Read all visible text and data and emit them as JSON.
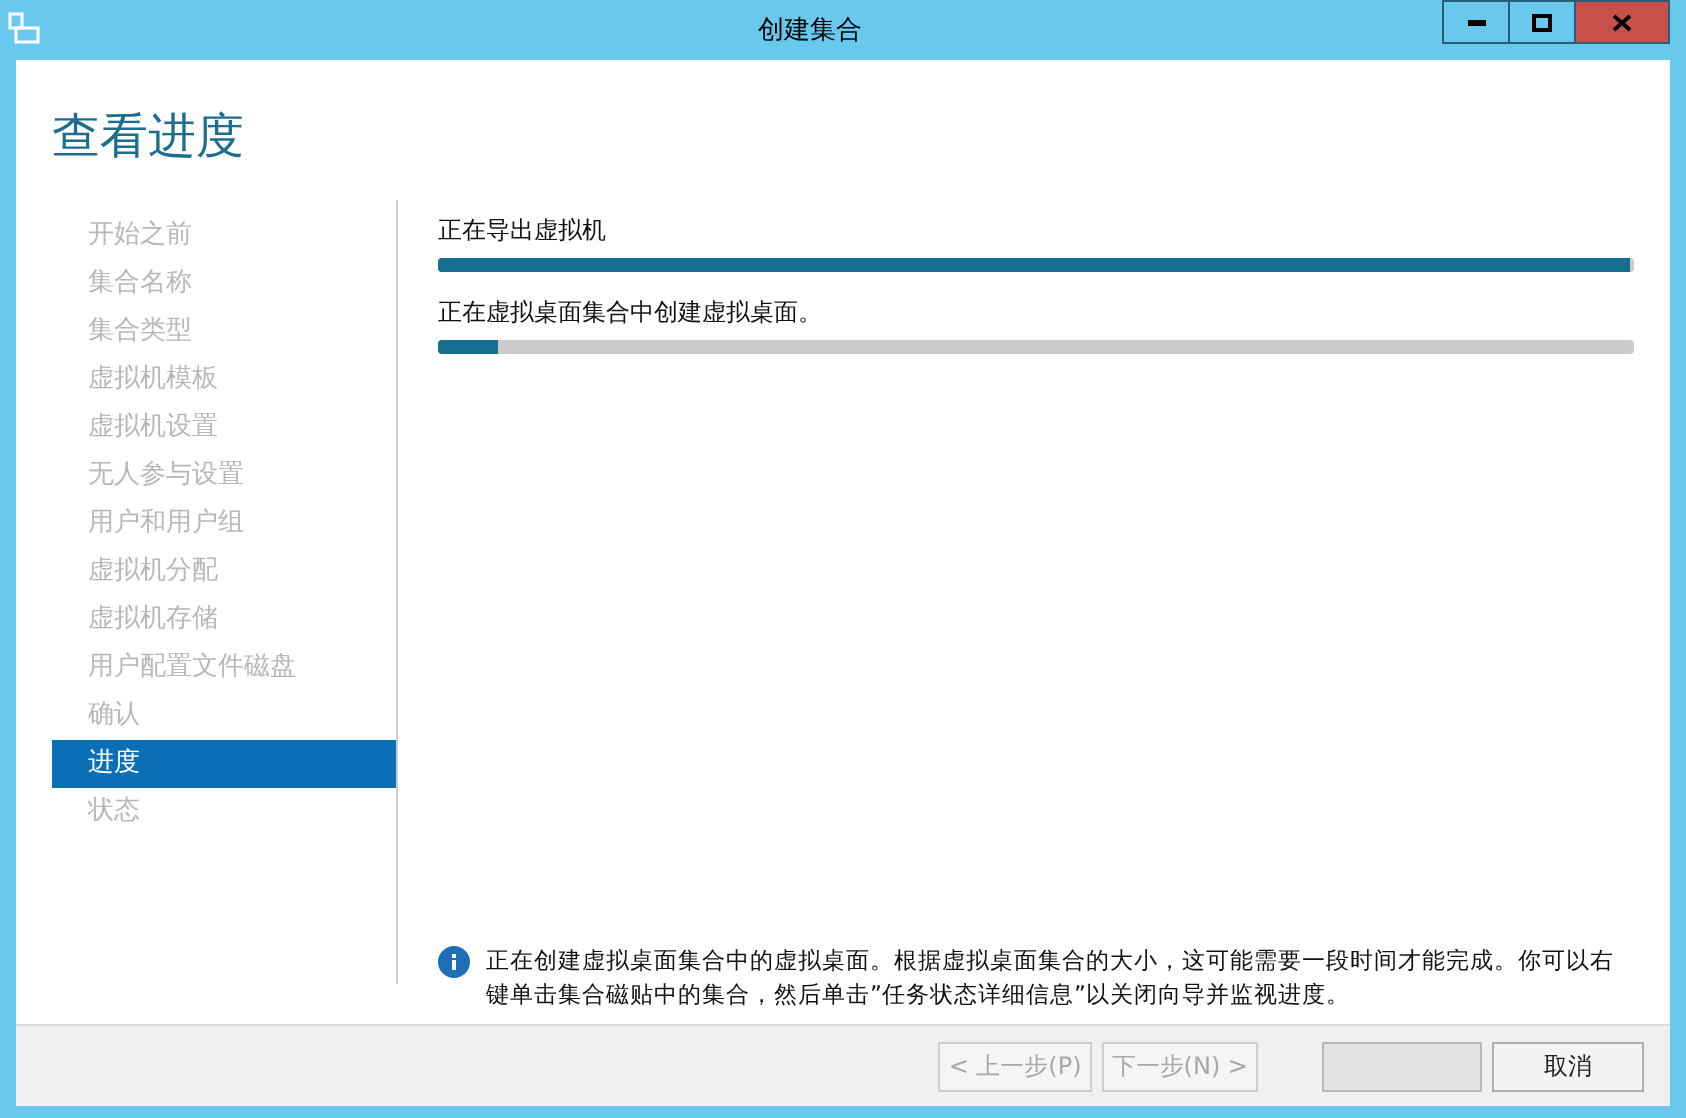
{
  "window": {
    "title": "创建集合"
  },
  "heading": "查看进度",
  "steps": [
    {
      "label": "开始之前",
      "selected": false
    },
    {
      "label": "集合名称",
      "selected": false
    },
    {
      "label": "集合类型",
      "selected": false
    },
    {
      "label": "虚拟机模板",
      "selected": false
    },
    {
      "label": "虚拟机设置",
      "selected": false
    },
    {
      "label": "无人参与设置",
      "selected": false
    },
    {
      "label": "用户和用户组",
      "selected": false
    },
    {
      "label": "虚拟机分配",
      "selected": false
    },
    {
      "label": "虚拟机存储",
      "selected": false
    },
    {
      "label": "用户配置文件磁盘",
      "selected": false
    },
    {
      "label": "确认",
      "selected": false
    },
    {
      "label": "进度",
      "selected": true
    },
    {
      "label": "状态",
      "selected": false
    }
  ],
  "tasks": [
    {
      "label": "正在导出虚拟机",
      "level": 0.997
    },
    {
      "label": "正在虚拟桌面集合中创建虚拟桌面。",
      "level": 0.05
    }
  ],
  "info": "正在创建虚拟桌面集合中的虚拟桌面。根据虚拟桌面集合的大小，这可能需要一段时间才能完成。你可以右键单击集合磁贴中的集合，然后单击”任务状态详细信息”以关闭向导并监视进度。",
  "buttons": [
    {
      "label": "< 上一步(P)",
      "disabled": true
    },
    {
      "label": "下一步(N) >",
      "disabled": true
    },
    {
      "disabled": true
    },
    {
      "label": "取消",
      "disabled": false
    }
  ]
}
